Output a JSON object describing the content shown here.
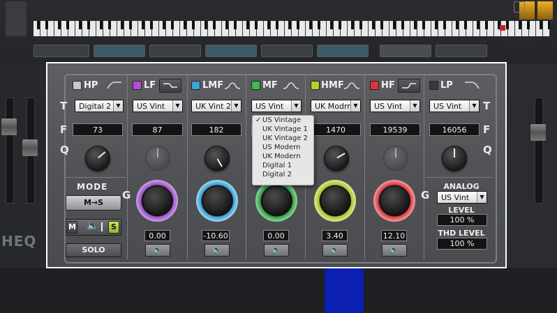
{
  "host": {
    "logo_text": "HEQ",
    "background_buttons": [
      "",
      "",
      "",
      "",
      "",
      "",
      "",
      ""
    ]
  },
  "bands": [
    {
      "id": "hp",
      "label": "HP",
      "led_color": "#b9b9b9",
      "led_on": false,
      "type": "Digital 2",
      "freq": "73",
      "shape": "highpass"
    },
    {
      "id": "lf",
      "label": "LF",
      "led_color": "#b84cd6",
      "led_on": true,
      "type": "US Vint",
      "freq": "87",
      "gain": "0.00",
      "shape": "shelf-low",
      "ring_color": "#9b4cc7"
    },
    {
      "id": "lmf",
      "label": "LMF",
      "led_color": "#3fa3d6",
      "led_on": true,
      "type": "UK Vint 2",
      "freq": "182",
      "gain": "-10.60",
      "shape": "bell",
      "ring_color": "#2f9bd0"
    },
    {
      "id": "mf",
      "label": "MF",
      "led_color": "#3dbb4f",
      "led_on": true,
      "type": "US Vint",
      "freq": "",
      "gain": "0.00",
      "shape": "bell",
      "ring_color": "#2d9c3f"
    },
    {
      "id": "hmf",
      "label": "HMF",
      "led_color": "#b8cf2e",
      "led_on": true,
      "type": "UK Modrn",
      "freq": "1470",
      "gain": "3.40",
      "shape": "bell",
      "ring_color": "#a9c02a"
    },
    {
      "id": "hf",
      "label": "HF",
      "led_color": "#e0333c",
      "led_on": true,
      "type": "US Vint",
      "freq": "19539",
      "gain": "12.10",
      "shape": "shelf-high",
      "ring_color": "#d6373c"
    },
    {
      "id": "lp",
      "label": "LP",
      "led_color": "#444",
      "led_on": false,
      "type": "US Vint",
      "freq": "16056",
      "shape": "lowpass"
    }
  ],
  "row_letters": {
    "type": "T",
    "freq": "F",
    "q": "Q",
    "gain": "G"
  },
  "mode": {
    "title": "MODE",
    "ms_button": "M→S",
    "m_label": "M",
    "s_label": "S",
    "solo": "SOLO"
  },
  "analog": {
    "title": "ANALOG",
    "type": "US Vint",
    "level_title": "LEVEL",
    "level_value": "100 %",
    "thd_title": "THD LEVEL",
    "thd_value": "100 %"
  },
  "dropdown": {
    "selected": "US Vintage",
    "check": "✓",
    "options": [
      "US Vintage",
      "UK Vintage 1",
      "UK Vintage 2",
      "US Modern",
      "UK Modern",
      "Digital 1",
      "Digital 2"
    ]
  },
  "icons": {
    "speaker": "speaker-icon",
    "arrow": "chevron-down-icon"
  }
}
